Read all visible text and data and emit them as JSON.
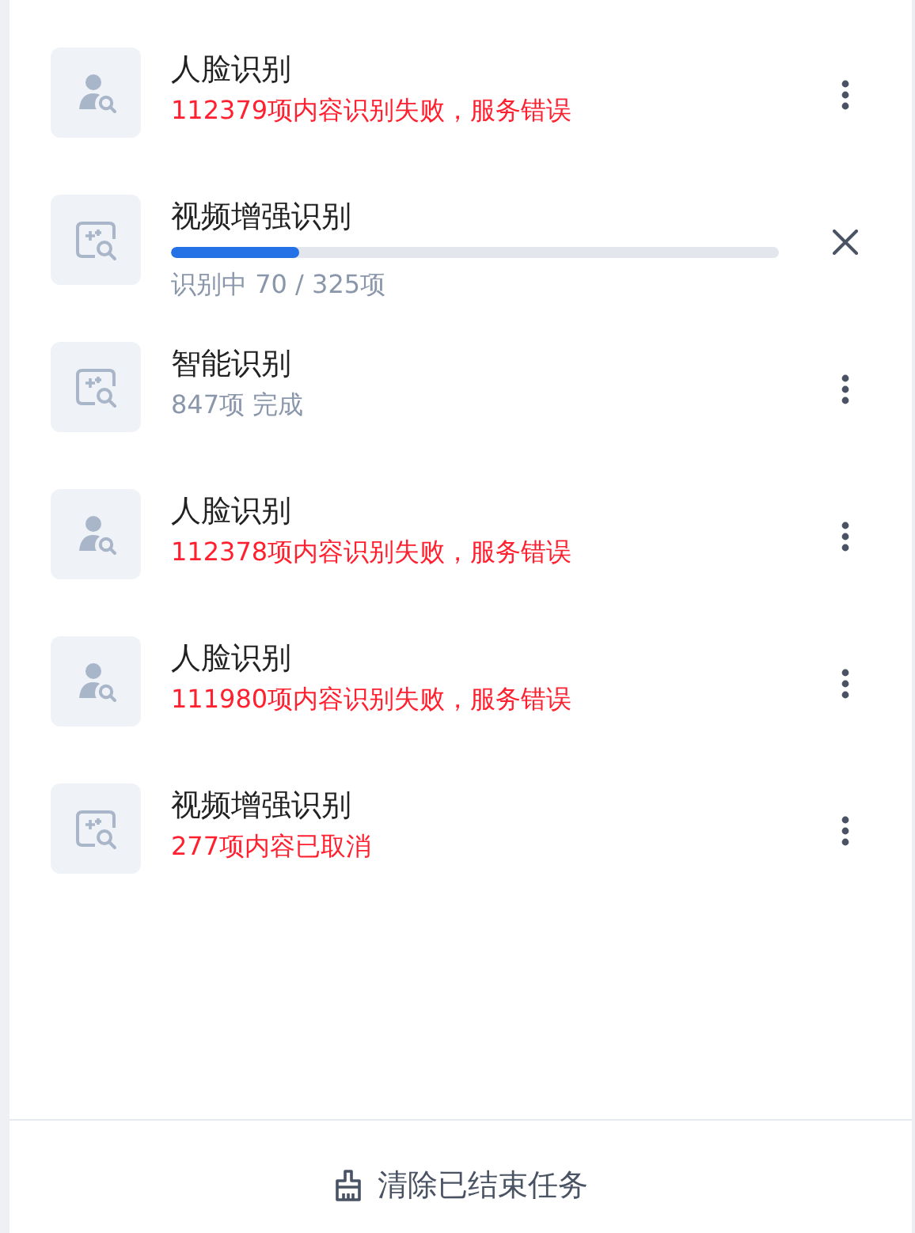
{
  "tasks": [
    {
      "kind": "face",
      "title": "人脸识别",
      "status": {
        "kind": "error",
        "text": "112379项内容识别失败，服务错误"
      }
    },
    {
      "kind": "enhance",
      "title": "视频增强识别",
      "status": {
        "kind": "progress",
        "level": 0.21,
        "text": "识别中 70 / 325项"
      }
    },
    {
      "kind": "enhance",
      "title": "智能识别",
      "status": {
        "kind": "done",
        "text": "847项 完成"
      }
    },
    {
      "kind": "face",
      "title": "人脸识别",
      "status": {
        "kind": "error",
        "text": "112378项内容识别失败，服务错误"
      }
    },
    {
      "kind": "face",
      "title": "人脸识别",
      "status": {
        "kind": "error",
        "text": "111980项内容识别失败，服务错误"
      }
    },
    {
      "kind": "enhance",
      "title": "视频增强识别",
      "status": {
        "kind": "error",
        "text": "277项内容已取消"
      }
    }
  ],
  "footer": {
    "button": "清除已结束任务"
  }
}
